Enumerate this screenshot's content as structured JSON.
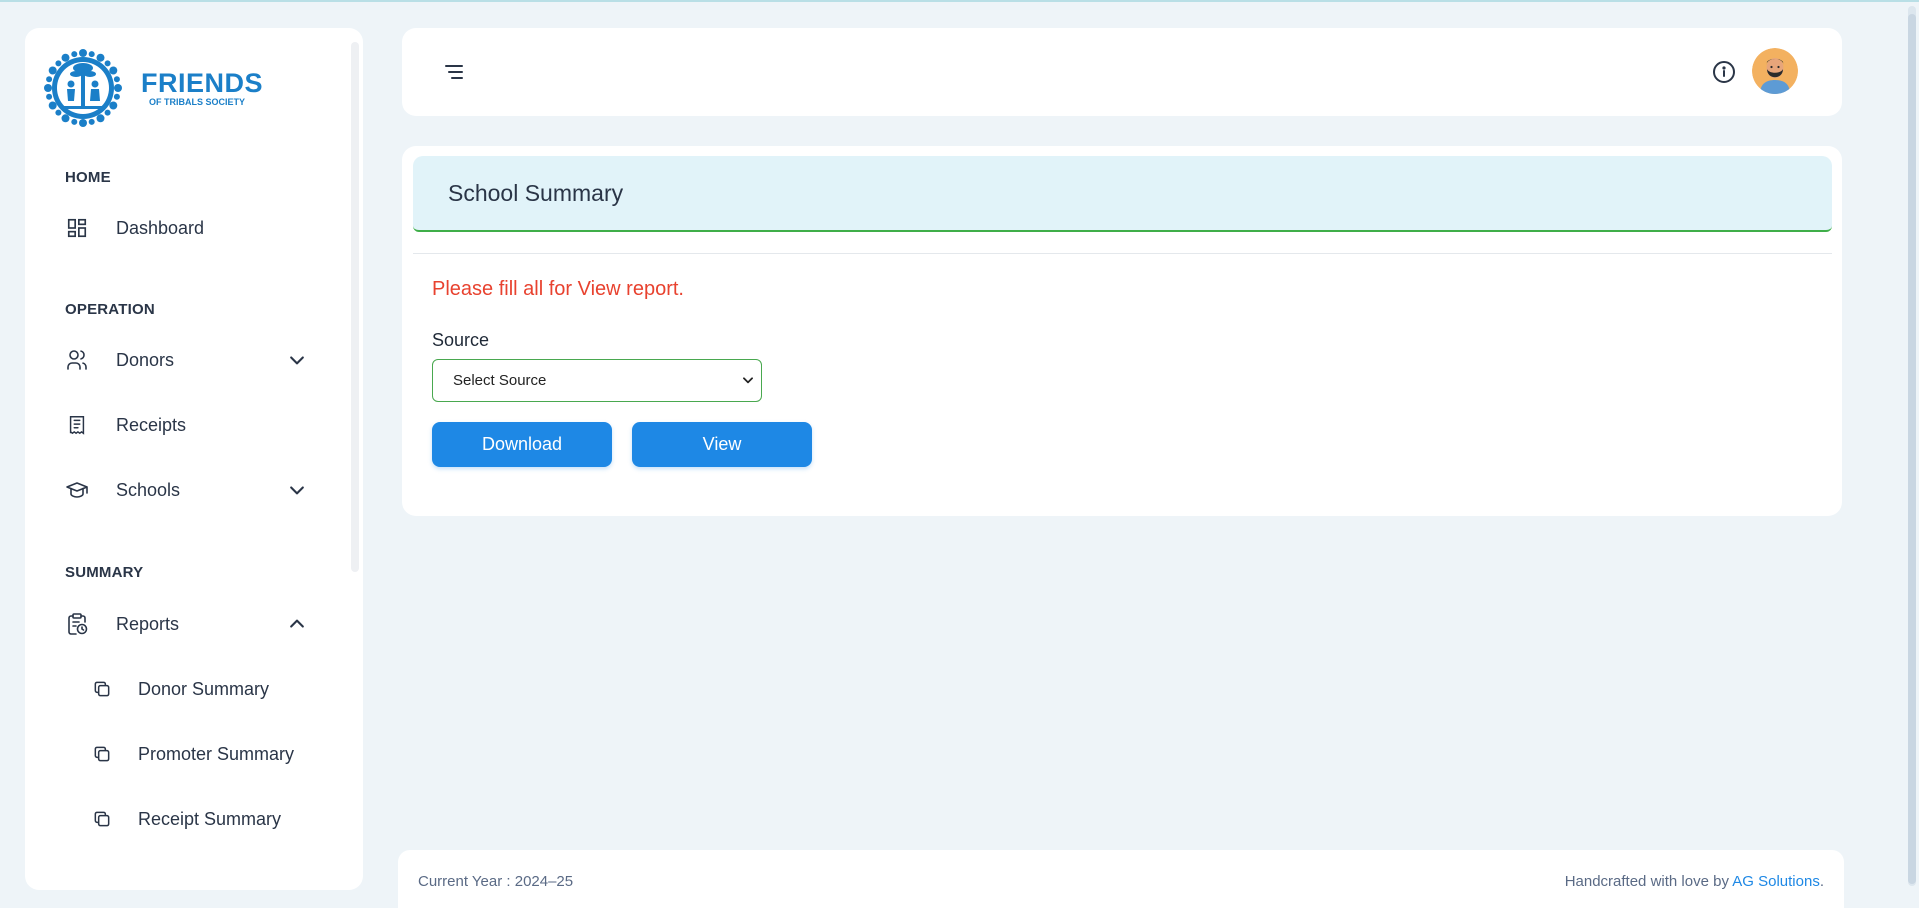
{
  "brand": {
    "name": "FRIENDS",
    "tagline": "OF TRIBALS SOCIETY",
    "accent": "#1b7fc8"
  },
  "sidebar": {
    "sections": [
      {
        "label": "HOME"
      },
      {
        "label": "OPERATION"
      },
      {
        "label": "SUMMARY"
      }
    ],
    "items": [
      {
        "label": "Dashboard",
        "icon": "dashboard-icon"
      },
      {
        "label": "Donors",
        "icon": "users-icon",
        "expanded": false
      },
      {
        "label": "Receipts",
        "icon": "receipt-icon"
      },
      {
        "label": "Schools",
        "icon": "graduation-cap-icon",
        "expanded": false
      },
      {
        "label": "Reports",
        "icon": "clipboard-clock-icon",
        "expanded": true
      }
    ],
    "subitems": [
      {
        "label": "Donor Summary",
        "icon": "copy-icon"
      },
      {
        "label": "Promoter Summary",
        "icon": "copy-icon"
      },
      {
        "label": "Receipt Summary",
        "icon": "copy-icon"
      }
    ]
  },
  "header": {
    "menu_icon": "menu-icon",
    "info_icon": "info-icon"
  },
  "main": {
    "title": "School Summary",
    "warning": "Please fill all for View report.",
    "source_label": "Source",
    "source_value": "Select Source",
    "download_label": "Download",
    "view_label": "View",
    "colors": {
      "primary": "#1e88e5",
      "warning": "#e8422f",
      "success_border": "#3fae49",
      "header_bg": "#e1f3f9"
    }
  },
  "footer": {
    "current_year": "Current Year : 2024–25",
    "credit_prefix": "Handcrafted with love by ",
    "credit_brand": "AG Solutions",
    "credit_suffix": "."
  }
}
